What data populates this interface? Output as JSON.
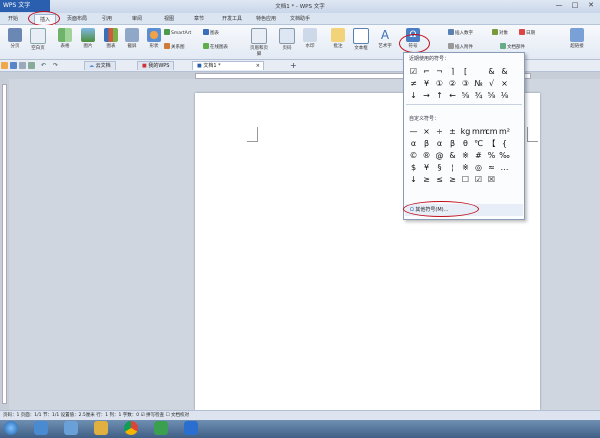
{
  "app": {
    "button": "WPS 文字",
    "title": "文档1 * - WPS 文字"
  },
  "window_controls": [
    "—",
    "□",
    "✕"
  ],
  "menu": {
    "tabs": [
      "开始",
      "插入",
      "页面布局",
      "引用",
      "审阅",
      "视图",
      "章节",
      "开发工具",
      "特色应用",
      "文档助手"
    ],
    "active": "插入"
  },
  "ribbon": {
    "buttons": [
      "分页",
      "空白页",
      "表格",
      "图片",
      "图表",
      "截屏",
      "形状",
      "页眉和页脚",
      "页码",
      "水印",
      "批注",
      "文本框",
      "艺术字",
      "符号",
      "超链接"
    ],
    "small": {
      "smartart": "SmartArt",
      "chart": "图表",
      "relation": "关系图",
      "online_chart": "在线图表",
      "insert_number": "插入数字",
      "object": "对象",
      "attachment": "插入附件",
      "date": "日期",
      "doc_parts": "文档部件"
    }
  },
  "doc_tabs": [
    "云文档",
    "我的WPS",
    "文档1 *"
  ],
  "symbol_panel": {
    "recent_header": "近期使用的符号：",
    "recent_rows": [
      [
        "☑",
        "⌐",
        "¬",
        "⌉",
        "[",
        "",
        "&",
        "&"
      ],
      [
        "≠",
        "¥",
        "①",
        "②",
        "③",
        "№",
        "√",
        "×"
      ],
      [
        "↓",
        "→",
        "↑",
        "←",
        "⅝",
        "¾",
        "⅝",
        "⅛"
      ]
    ],
    "custom_header": "自定义符号：",
    "custom_rows": [
      [
        "—",
        "×",
        "÷",
        "±",
        "kg",
        "mm",
        "cm",
        "m²"
      ],
      [
        "α",
        "β",
        "α",
        "β",
        "θ",
        "℃",
        "【",
        "{"
      ],
      [
        "©",
        "®",
        "@",
        "&",
        "※",
        "#",
        "%",
        "‰"
      ],
      [
        "$",
        "¥",
        "§",
        "¦",
        "※",
        "◎",
        "≈",
        "…"
      ],
      [
        "↓",
        "≥",
        "≤",
        "≥",
        "☐",
        "☑",
        "☒",
        ""
      ]
    ],
    "more": "其他符号(M)..."
  },
  "statusbar": "页码：1   页面：1/1   节：1/1   设置值：2.5厘米   行：1   列：1   字数：0   ☑ 拼写检查   ☐ 文档校对",
  "colors": {
    "highlight": "#c0121e",
    "title_blue": "#2a5fb0"
  }
}
